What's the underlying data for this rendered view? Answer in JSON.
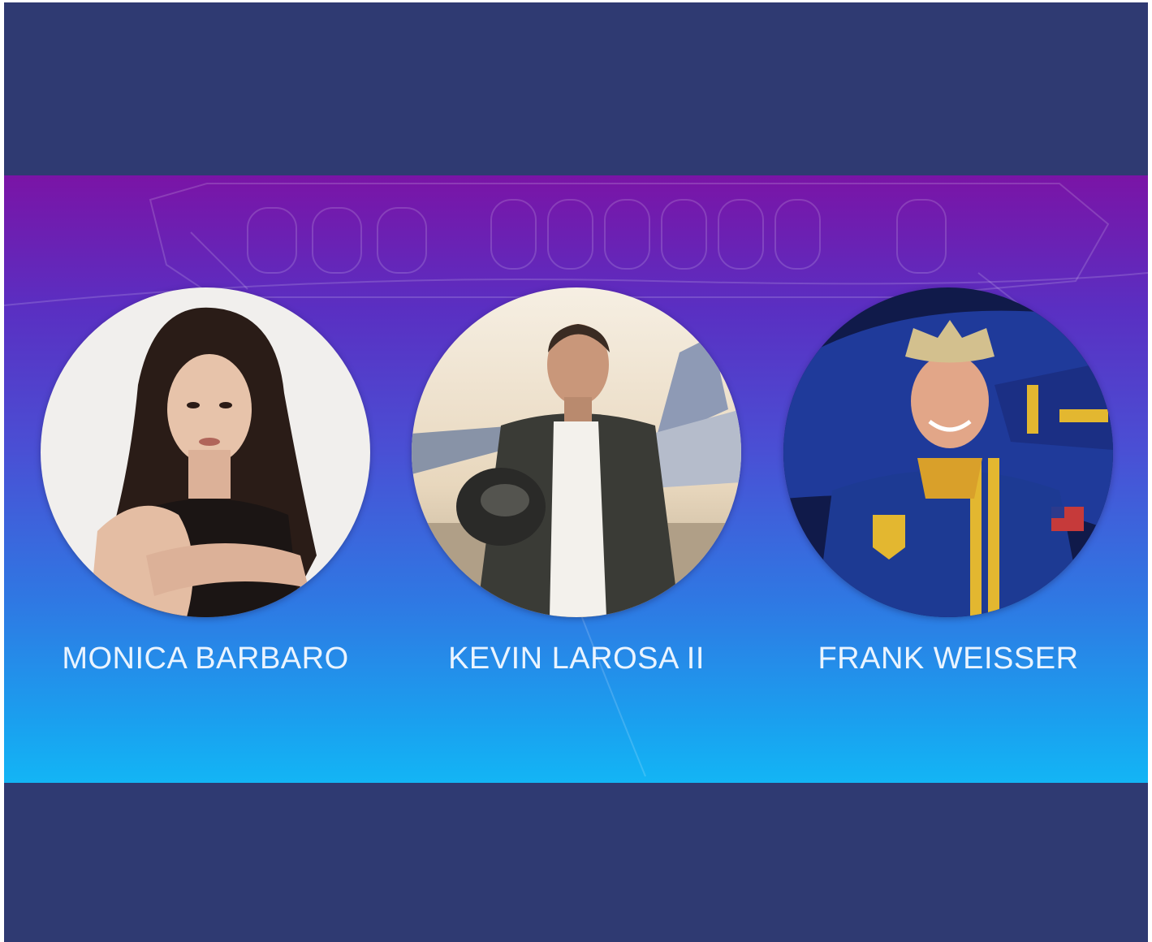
{
  "speakers": [
    {
      "name": "MONICA BARBARO"
    },
    {
      "name": "KEVIN LAROSA II"
    },
    {
      "name": "FRANK WEISSER"
    }
  ],
  "colors": {
    "frame": "#2f3a72",
    "band_top": "#7a14a6",
    "band_bottom": "#13b5f5",
    "name_text": "#eaf4ff"
  }
}
